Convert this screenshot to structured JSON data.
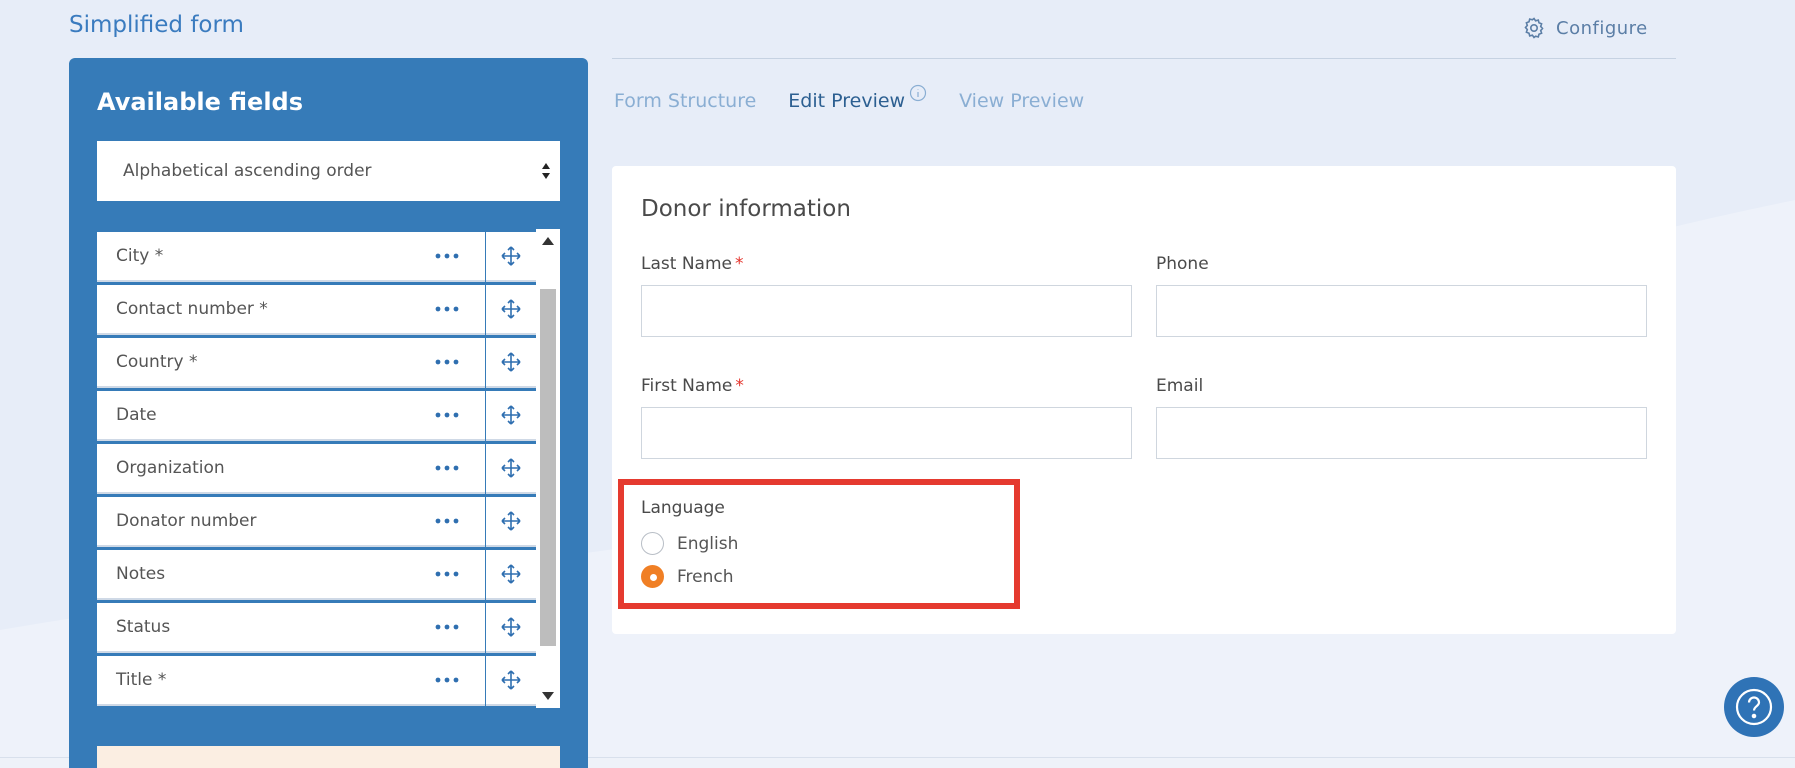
{
  "header": {
    "title": "Simplified form",
    "configure_label": "Configure"
  },
  "sidebar": {
    "title": "Available fields",
    "sort_selected": "Alphabetical ascending order",
    "fields": [
      {
        "label": "City *"
      },
      {
        "label": "Contact number *"
      },
      {
        "label": "Country *"
      },
      {
        "label": "Date"
      },
      {
        "label": "Organization"
      },
      {
        "label": "Donator number"
      },
      {
        "label": "Notes"
      },
      {
        "label": "Status"
      },
      {
        "label": "Title *"
      }
    ]
  },
  "tabs": [
    {
      "label": "Form Structure",
      "active": false
    },
    {
      "label": "Edit Preview",
      "active": true
    },
    {
      "label": "View Preview",
      "active": false
    }
  ],
  "form": {
    "section_title": "Donor information",
    "last_name_label": "Last Name",
    "phone_label": "Phone",
    "first_name_label": "First Name",
    "email_label": "Email",
    "required_mark": "*",
    "language": {
      "label": "Language",
      "options": [
        {
          "label": "English",
          "checked": false
        },
        {
          "label": "French",
          "checked": true
        }
      ]
    }
  },
  "colors": {
    "panel": "#367bb8",
    "accent_orange": "#f07f25",
    "highlight_red": "#e53a2f",
    "title_blue": "#3a7bbf"
  },
  "icons": [
    "gear-icon",
    "info-icon",
    "more-dots-icon",
    "move-icon",
    "help-icon",
    "sort-arrows-icon"
  ]
}
